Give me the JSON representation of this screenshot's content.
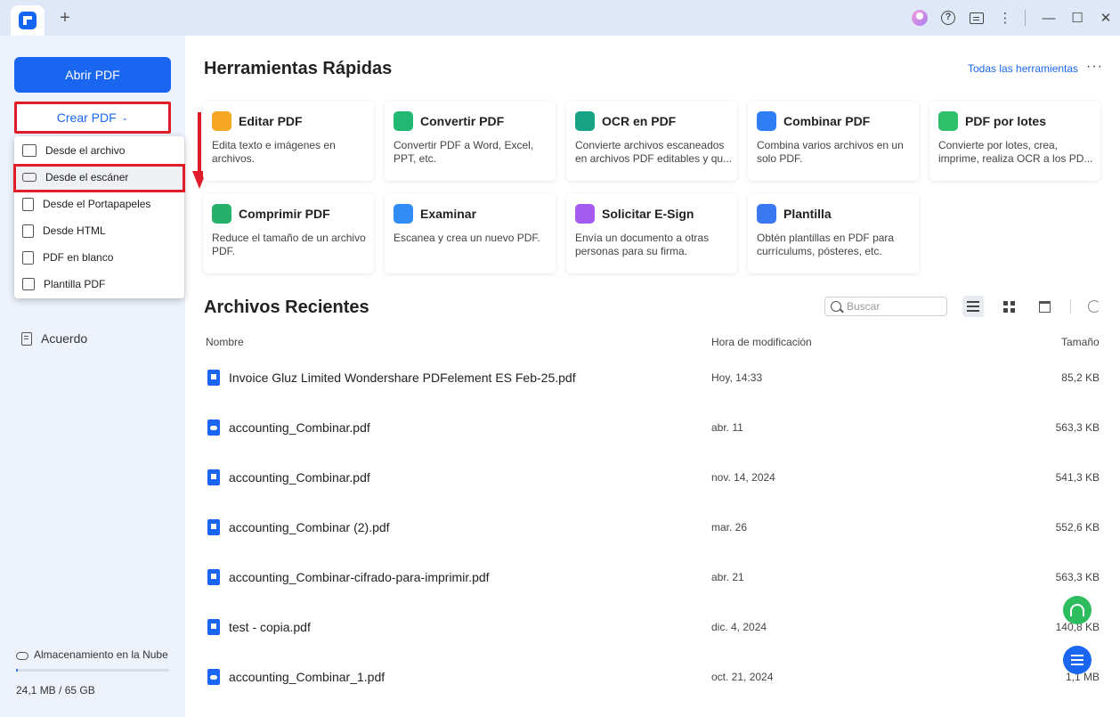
{
  "colors": {
    "accent": "#1a66f0",
    "highlight_border": "#e11d2a",
    "sidebar_bg": "#edf2fb"
  },
  "sidebar": {
    "open_pdf": "Abrir PDF",
    "create_pdf": "Crear PDF",
    "items": [
      {
        "label": "Acuerdo",
        "icon": "document-icon"
      }
    ],
    "cloud": {
      "label": "Almacenamiento en la Nube",
      "usage": "24,1 MB / 65 GB",
      "fill": 0.0004
    }
  },
  "dropdown": {
    "items": [
      {
        "label": "Desde el archivo",
        "icon": "folder-icon"
      },
      {
        "label": "Desde el escáner",
        "icon": "scanner-icon"
      },
      {
        "label": "Desde el Portapapeles",
        "icon": "clipboard-icon"
      },
      {
        "label": "Desde HTML",
        "icon": "html-icon"
      },
      {
        "label": "PDF en blanco",
        "icon": "blank-page-icon"
      },
      {
        "label": "Plantilla PDF",
        "icon": "template-icon"
      }
    ]
  },
  "quick_tools": {
    "title": "Herramientas Rápidas",
    "all_tools": "Todas las herramientas",
    "cards": [
      {
        "title": "Editar PDF",
        "desc": "Edita texto e imágenes en archivos.",
        "color": "#f5a623"
      },
      {
        "title": "Convertir PDF",
        "desc": "Convertir PDF a Word, Excel, PPT, etc.",
        "color": "#21b873"
      },
      {
        "title": "OCR en PDF",
        "desc": "Convierte archivos escaneados en archivos PDF editables y qu...",
        "color": "#16a383"
      },
      {
        "title": "Combinar PDF",
        "desc": "Combina varios archivos en un solo PDF.",
        "color": "#2f7df5"
      },
      {
        "title": "PDF por lotes",
        "desc": "Convierte por lotes, crea, imprime, realiza OCR a los PD...",
        "color": "#2fbf6a"
      },
      {
        "title": "Comprimir PDF",
        "desc": "Reduce el tamaño de un archivo PDF.",
        "color": "#27b06a"
      },
      {
        "title": "Examinar",
        "desc": "Escanea y crea un nuevo PDF.",
        "color": "#2f8df5"
      },
      {
        "title": "Solicitar E-Sign",
        "desc": "Envía un documento a otras personas para su firma.",
        "color": "#a65bf0"
      },
      {
        "title": "Plantilla",
        "desc": "Obtén plantillas en PDF para currículums, pósteres, etc.",
        "color": "#3a78f2"
      }
    ]
  },
  "recent": {
    "title": "Archivos Recientes",
    "search_placeholder": "Buscar",
    "columns": {
      "name": "Nombre",
      "modified": "Hora de modificación",
      "size": "Tamaño"
    },
    "files": [
      {
        "name": "Invoice Gluz Limited Wondershare PDFelement ES Feb-25.pdf",
        "date": "Hoy, 14:33",
        "size": "85,2 KB",
        "cloud": false
      },
      {
        "name": "accounting_Combinar.pdf",
        "date": "abr. 11",
        "size": "563,3 KB",
        "cloud": true
      },
      {
        "name": "accounting_Combinar.pdf",
        "date": "nov. 14, 2024",
        "size": "541,3 KB",
        "cloud": false
      },
      {
        "name": "accounting_Combinar (2).pdf",
        "date": "mar. 26",
        "size": "552,6 KB",
        "cloud": false
      },
      {
        "name": "accounting_Combinar-cifrado-para-imprimir.pdf",
        "date": "abr. 21",
        "size": "563,3 KB",
        "cloud": false
      },
      {
        "name": "test - copia.pdf",
        "date": "dic. 4, 2024",
        "size": "140,8 KB",
        "cloud": false
      },
      {
        "name": "accounting_Combinar_1.pdf",
        "date": "oct. 21, 2024",
        "size": "1,1 MB",
        "cloud": true
      }
    ]
  }
}
